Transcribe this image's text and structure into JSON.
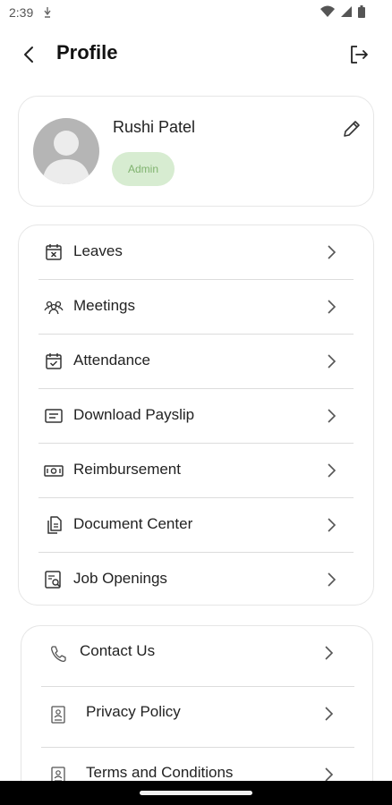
{
  "status_bar": {
    "time": "2:39"
  },
  "header": {
    "title": "Profile"
  },
  "profile": {
    "name": "Rushi Patel",
    "role": "Admin"
  },
  "menu": [
    {
      "label": "Leaves",
      "icon": "calendar-x-icon"
    },
    {
      "label": "Meetings",
      "icon": "people-group-icon"
    },
    {
      "label": "Attendance",
      "icon": "calendar-check-icon"
    },
    {
      "label": "Download Payslip",
      "icon": "receipt-icon"
    },
    {
      "label": "Reimbursement",
      "icon": "money-icon"
    },
    {
      "label": "Document Center",
      "icon": "documents-icon"
    },
    {
      "label": "Job Openings",
      "icon": "job-search-icon"
    }
  ],
  "info": [
    {
      "label": "Contact Us",
      "icon": "phone-icon"
    },
    {
      "label": "Privacy Policy",
      "icon": "id-card-icon"
    },
    {
      "label": "Terms and Conditions",
      "icon": "id-card-icon"
    }
  ],
  "colors": {
    "badge_bg": "#d7ecd1",
    "badge_text": "#7fb26e",
    "avatar": "#b5b5b5"
  }
}
